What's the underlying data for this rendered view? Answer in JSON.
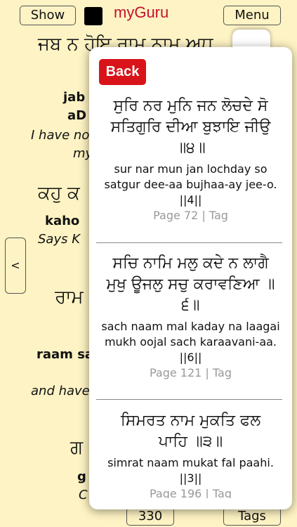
{
  "header": {
    "show_label": "Show",
    "app_title": "myGuru",
    "menu_label": "Menu"
  },
  "background": {
    "line1_gurmukhi": "ਜਬ ਨ ਹੋਇ ਰਾਮ ਨਾਮ ਅਧ",
    "line2_bold": "jab",
    "line2b_bold": "aD",
    "line3_italic": "I have no",
    "line3b_italic": "my",
    "line4_gurmukhi": "ਕਹੁ ਕ",
    "line5_bold": "kaho",
    "line6_italic": "Says K",
    "line7_gurmukhi": "ਰਾਮ",
    "line8_bold": "raam sa",
    "line9_italic": "and have",
    "line10_gurmukhi": "ਗ",
    "line11_bold": "g",
    "line12_italic": "C"
  },
  "nav": {
    "prev_label": "<",
    "page_number": "330",
    "tags_label": "Tags"
  },
  "popover": {
    "back_label": "Back",
    "entries": [
      {
        "gurmukhi": "ਸੁਰਿ ਨਰ ਮੁਨਿ ਜਨ ਲੋਚਦੇ ਸੋ ਸਤਿਗੁਰਿ ਦੀਆ ਬੁਝਾਇ ਜੀਉ ॥੪॥",
        "translit": "sur nar mun jan lochday so satgur dee-aa bujhaa-ay jee-o. ||4||",
        "meta": "Page 72 | Tag"
      },
      {
        "gurmukhi": "ਸਚਿ ਨਾਮਿ ਮਲੁ ਕਦੇ ਨ ਲਾਗੈ ਮੁਖੁ ਊਜਲੁ ਸਚੁ ਕਰਾਵਣਿਆ ॥੬॥",
        "translit": "sach naam mal kaday na laagai mukh oojal sach karaavani-aa. ||6||",
        "meta": "Page 121 | Tag"
      },
      {
        "gurmukhi": "ਸਿਮਰਤ ਨਾਮ ਮੁਕਤਿ ਫਲ ਪਾਹਿ ॥੩॥",
        "translit": "simrat naam mukat fal paahi. ||3||",
        "meta": "Page 196 | Tag"
      }
    ]
  }
}
